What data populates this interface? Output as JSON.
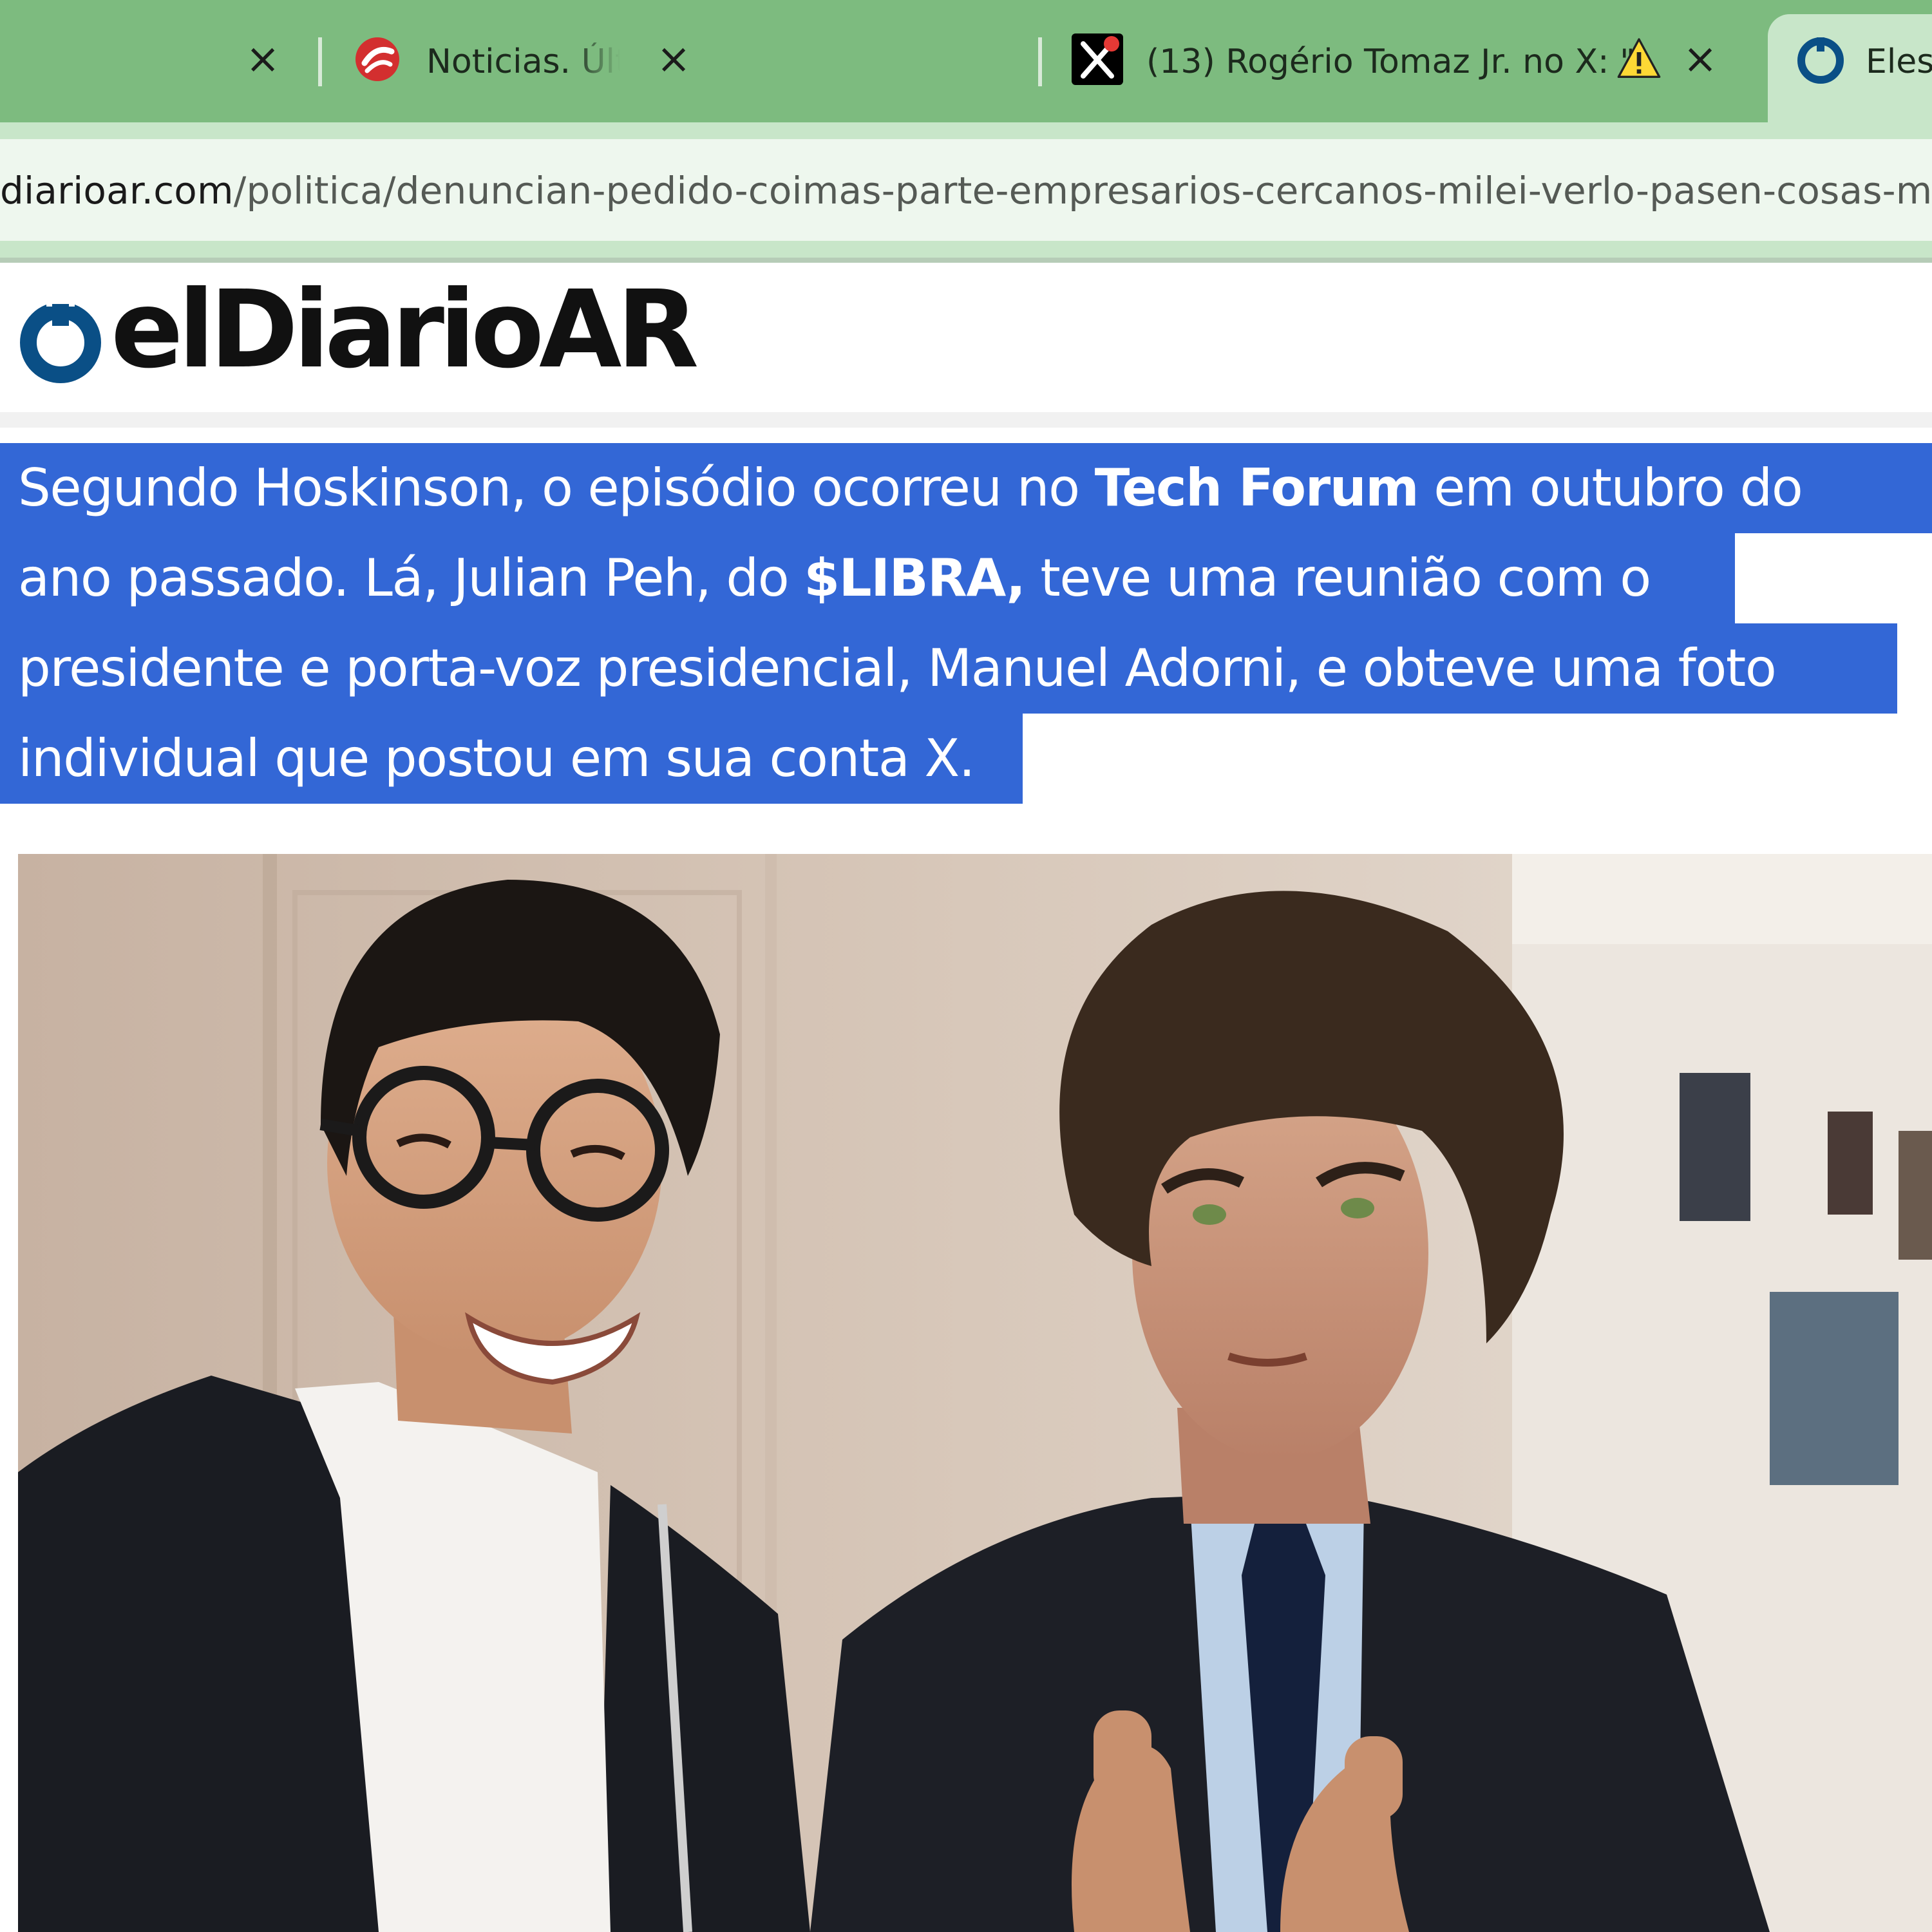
{
  "browser": {
    "tabs": [
      {
        "title": "",
        "favicon": "none",
        "close_label": "×"
      },
      {
        "title": "Noticias. Últimas noticias de Argentina",
        "favicon": "red-news-logo-icon",
        "close_label": "×"
      },
      {
        "title": "(13) Rogério Tomaz Jr. no X: \"",
        "favicon": "x-logo-icon",
        "warning": "warning-icon",
        "close_label": "×"
      },
      {
        "title": "Eles",
        "favicon": "eldiario-favicon-icon",
        "active": true
      }
    ],
    "address_bar": {
      "host": "diarioar.com",
      "path": "/politica/denuncian-pedido-coimas-parte-empresarios-cercanos-milei-verlo-pasen-cosas-m"
    }
  },
  "site": {
    "logo_text": "elDiarioAR",
    "brand_color": "#0a4f86"
  },
  "article": {
    "lines": [
      {
        "before": "Segundo Hoskinson, o episódio ocorreu no ",
        "bold": "Tech Forum",
        "after": " em outubro do"
      },
      {
        "before": "ano passado. Lá, Julian Peh, do ",
        "bold": "$LIBRA,",
        "after": " teve uma reunião com o"
      },
      {
        "text": "presidente e porta-voz presidencial, Manuel Adorni, e obteve uma foto"
      },
      {
        "text": "individual que postou em sua conta X."
      }
    ],
    "selection_color": "#3367d6"
  },
  "photo": {
    "subject": "two men in dark suits posing for a selfie indoors"
  }
}
